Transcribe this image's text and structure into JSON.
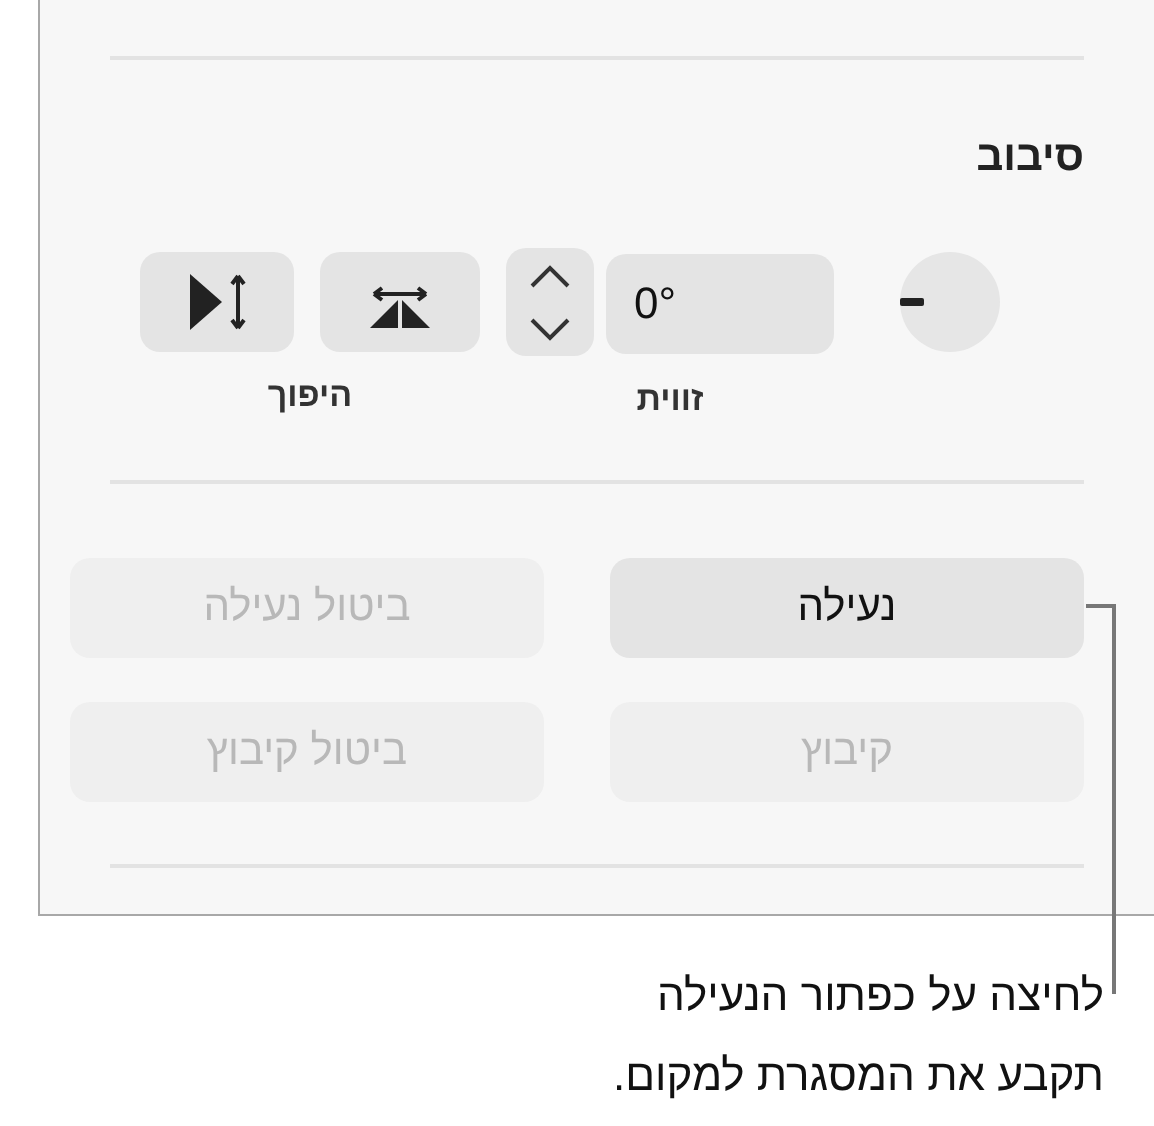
{
  "section": {
    "title": "סיבוב"
  },
  "rotate": {
    "angle_value": "0°",
    "angle_label": "זווית",
    "flip_label": "היפוך"
  },
  "buttons": [
    {
      "label": "נעילה",
      "disabled": false
    },
    {
      "label": "ביטול נעילה",
      "disabled": true
    },
    {
      "label": "קיבוץ",
      "disabled": true
    },
    {
      "label": "ביטול קיבוץ",
      "disabled": true
    }
  ],
  "caption": {
    "lines": [
      "לחיצה על כפתור הנעילה",
      "תקבע את המסגרת למקום."
    ]
  }
}
